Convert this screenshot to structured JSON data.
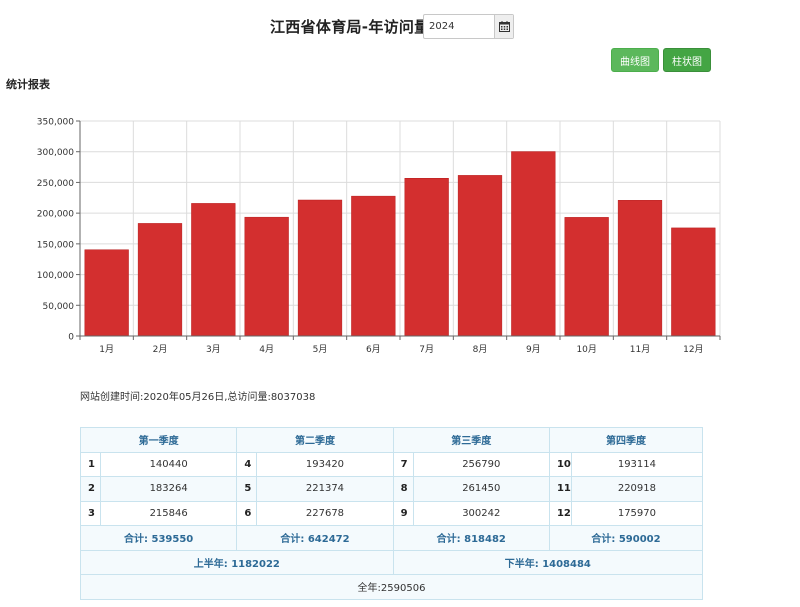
{
  "header": {
    "title": "江西省体育局-年访问量",
    "year_value": "2024"
  },
  "buttons": {
    "line_chart": "曲线图",
    "bar_chart": "柱状图"
  },
  "section_title": "统计报表",
  "colors": {
    "bar": "#d32f2f",
    "button_green": "#5cb85c",
    "table_header": "#2d6a96"
  },
  "chart_data": {
    "type": "bar",
    "categories": [
      "1月",
      "2月",
      "3月",
      "4月",
      "5月",
      "6月",
      "7月",
      "8月",
      "9月",
      "10月",
      "11月",
      "12月"
    ],
    "values": [
      140440,
      183264,
      215846,
      193420,
      221374,
      227678,
      256790,
      261450,
      300242,
      193114,
      220918,
      175970
    ],
    "ylim": [
      0,
      350000
    ],
    "yticks": [
      0,
      50000,
      100000,
      150000,
      200000,
      250000,
      300000,
      350000
    ],
    "ytick_labels": [
      "0",
      "50,000",
      "100,000",
      "150,000",
      "200,000",
      "250,000",
      "300,000",
      "350,000"
    ],
    "grid": true
  },
  "site_info": "网站创建时间:2020年05月26日,总访问量:8037038",
  "table": {
    "quarters": [
      "第一季度",
      "第二季度",
      "第三季度",
      "第四季度"
    ],
    "rows": [
      [
        {
          "n": "1",
          "v": "140440"
        },
        {
          "n": "4",
          "v": "193420"
        },
        {
          "n": "7",
          "v": "256790"
        },
        {
          "n": "10",
          "v": "193114"
        }
      ],
      [
        {
          "n": "2",
          "v": "183264"
        },
        {
          "n": "5",
          "v": "221374"
        },
        {
          "n": "8",
          "v": "261450"
        },
        {
          "n": "11",
          "v": "220918"
        }
      ],
      [
        {
          "n": "3",
          "v": "215846"
        },
        {
          "n": "6",
          "v": "227678"
        },
        {
          "n": "9",
          "v": "300242"
        },
        {
          "n": "12",
          "v": "175970"
        }
      ]
    ],
    "sum_label": "合计:",
    "sums": [
      "539550",
      "642472",
      "818482",
      "590002"
    ],
    "first_half_label": "上半年:",
    "first_half": "1182022",
    "second_half_label": "下半年:",
    "second_half": "1408484",
    "year_total": "全年:2590506"
  }
}
